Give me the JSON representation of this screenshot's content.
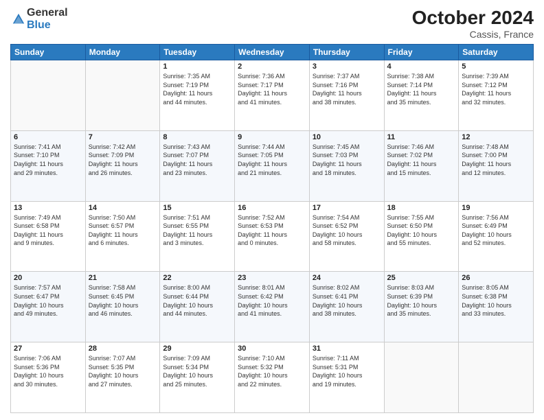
{
  "logo": {
    "general": "General",
    "blue": "Blue"
  },
  "header": {
    "month": "October 2024",
    "location": "Cassis, France"
  },
  "days_of_week": [
    "Sunday",
    "Monday",
    "Tuesday",
    "Wednesday",
    "Thursday",
    "Friday",
    "Saturday"
  ],
  "weeks": [
    [
      {
        "day": "",
        "info": ""
      },
      {
        "day": "",
        "info": ""
      },
      {
        "day": "1",
        "info": "Sunrise: 7:35 AM\nSunset: 7:19 PM\nDaylight: 11 hours\nand 44 minutes."
      },
      {
        "day": "2",
        "info": "Sunrise: 7:36 AM\nSunset: 7:17 PM\nDaylight: 11 hours\nand 41 minutes."
      },
      {
        "day": "3",
        "info": "Sunrise: 7:37 AM\nSunset: 7:16 PM\nDaylight: 11 hours\nand 38 minutes."
      },
      {
        "day": "4",
        "info": "Sunrise: 7:38 AM\nSunset: 7:14 PM\nDaylight: 11 hours\nand 35 minutes."
      },
      {
        "day": "5",
        "info": "Sunrise: 7:39 AM\nSunset: 7:12 PM\nDaylight: 11 hours\nand 32 minutes."
      }
    ],
    [
      {
        "day": "6",
        "info": "Sunrise: 7:41 AM\nSunset: 7:10 PM\nDaylight: 11 hours\nand 29 minutes."
      },
      {
        "day": "7",
        "info": "Sunrise: 7:42 AM\nSunset: 7:09 PM\nDaylight: 11 hours\nand 26 minutes."
      },
      {
        "day": "8",
        "info": "Sunrise: 7:43 AM\nSunset: 7:07 PM\nDaylight: 11 hours\nand 23 minutes."
      },
      {
        "day": "9",
        "info": "Sunrise: 7:44 AM\nSunset: 7:05 PM\nDaylight: 11 hours\nand 21 minutes."
      },
      {
        "day": "10",
        "info": "Sunrise: 7:45 AM\nSunset: 7:03 PM\nDaylight: 11 hours\nand 18 minutes."
      },
      {
        "day": "11",
        "info": "Sunrise: 7:46 AM\nSunset: 7:02 PM\nDaylight: 11 hours\nand 15 minutes."
      },
      {
        "day": "12",
        "info": "Sunrise: 7:48 AM\nSunset: 7:00 PM\nDaylight: 11 hours\nand 12 minutes."
      }
    ],
    [
      {
        "day": "13",
        "info": "Sunrise: 7:49 AM\nSunset: 6:58 PM\nDaylight: 11 hours\nand 9 minutes."
      },
      {
        "day": "14",
        "info": "Sunrise: 7:50 AM\nSunset: 6:57 PM\nDaylight: 11 hours\nand 6 minutes."
      },
      {
        "day": "15",
        "info": "Sunrise: 7:51 AM\nSunset: 6:55 PM\nDaylight: 11 hours\nand 3 minutes."
      },
      {
        "day": "16",
        "info": "Sunrise: 7:52 AM\nSunset: 6:53 PM\nDaylight: 11 hours\nand 0 minutes."
      },
      {
        "day": "17",
        "info": "Sunrise: 7:54 AM\nSunset: 6:52 PM\nDaylight: 10 hours\nand 58 minutes."
      },
      {
        "day": "18",
        "info": "Sunrise: 7:55 AM\nSunset: 6:50 PM\nDaylight: 10 hours\nand 55 minutes."
      },
      {
        "day": "19",
        "info": "Sunrise: 7:56 AM\nSunset: 6:49 PM\nDaylight: 10 hours\nand 52 minutes."
      }
    ],
    [
      {
        "day": "20",
        "info": "Sunrise: 7:57 AM\nSunset: 6:47 PM\nDaylight: 10 hours\nand 49 minutes."
      },
      {
        "day": "21",
        "info": "Sunrise: 7:58 AM\nSunset: 6:45 PM\nDaylight: 10 hours\nand 46 minutes."
      },
      {
        "day": "22",
        "info": "Sunrise: 8:00 AM\nSunset: 6:44 PM\nDaylight: 10 hours\nand 44 minutes."
      },
      {
        "day": "23",
        "info": "Sunrise: 8:01 AM\nSunset: 6:42 PM\nDaylight: 10 hours\nand 41 minutes."
      },
      {
        "day": "24",
        "info": "Sunrise: 8:02 AM\nSunset: 6:41 PM\nDaylight: 10 hours\nand 38 minutes."
      },
      {
        "day": "25",
        "info": "Sunrise: 8:03 AM\nSunset: 6:39 PM\nDaylight: 10 hours\nand 35 minutes."
      },
      {
        "day": "26",
        "info": "Sunrise: 8:05 AM\nSunset: 6:38 PM\nDaylight: 10 hours\nand 33 minutes."
      }
    ],
    [
      {
        "day": "27",
        "info": "Sunrise: 7:06 AM\nSunset: 5:36 PM\nDaylight: 10 hours\nand 30 minutes."
      },
      {
        "day": "28",
        "info": "Sunrise: 7:07 AM\nSunset: 5:35 PM\nDaylight: 10 hours\nand 27 minutes."
      },
      {
        "day": "29",
        "info": "Sunrise: 7:09 AM\nSunset: 5:34 PM\nDaylight: 10 hours\nand 25 minutes."
      },
      {
        "day": "30",
        "info": "Sunrise: 7:10 AM\nSunset: 5:32 PM\nDaylight: 10 hours\nand 22 minutes."
      },
      {
        "day": "31",
        "info": "Sunrise: 7:11 AM\nSunset: 5:31 PM\nDaylight: 10 hours\nand 19 minutes."
      },
      {
        "day": "",
        "info": ""
      },
      {
        "day": "",
        "info": ""
      }
    ]
  ]
}
